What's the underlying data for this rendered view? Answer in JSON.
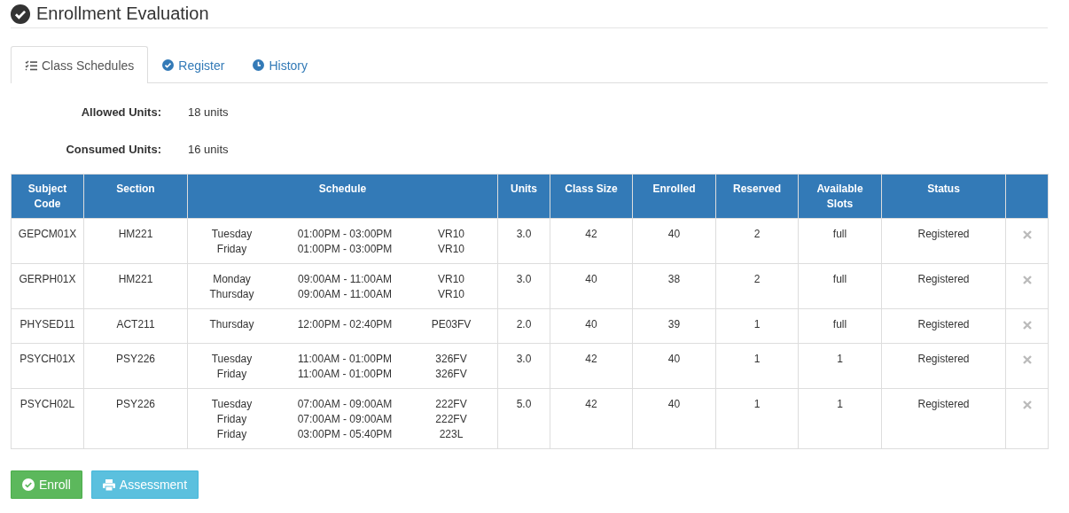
{
  "title": "Enrollment Evaluation",
  "tabs": [
    {
      "label": "Class Schedules",
      "selected": true
    },
    {
      "label": "Register",
      "selected": false
    },
    {
      "label": "History",
      "selected": false
    }
  ],
  "summary": [
    {
      "label": "Allowed Units:",
      "value": "18 units"
    },
    {
      "label": "Consumed Units:",
      "value": "16 units"
    }
  ],
  "table": {
    "columns": [
      "Subject Code",
      "Section",
      "Schedule",
      "Units",
      "Class Size",
      "Enrolled",
      "Reserved",
      "Available Slots",
      "Status"
    ],
    "rows": [
      {
        "subject_code": "GEPCM01X",
        "section": "HM221",
        "schedule": [
          {
            "day": "Tuesday",
            "time": "01:00PM - 03:00PM",
            "room": "VR10"
          },
          {
            "day": "Friday",
            "time": "01:00PM - 03:00PM",
            "room": "VR10"
          }
        ],
        "units": "3.0",
        "class_size": "42",
        "enrolled": "40",
        "reserved": "2",
        "available_slots": "full",
        "status": "Registered"
      },
      {
        "subject_code": "GERPH01X",
        "section": "HM221",
        "schedule": [
          {
            "day": "Monday",
            "time": "09:00AM - 11:00AM",
            "room": "VR10"
          },
          {
            "day": "Thursday",
            "time": "09:00AM - 11:00AM",
            "room": "VR10"
          }
        ],
        "units": "3.0",
        "class_size": "40",
        "enrolled": "38",
        "reserved": "2",
        "available_slots": "full",
        "status": "Registered"
      },
      {
        "subject_code": "PHYSED11",
        "section": "ACT211",
        "schedule": [
          {
            "day": "Thursday",
            "time": "12:00PM - 02:40PM",
            "room": "PE03FV"
          }
        ],
        "units": "2.0",
        "class_size": "40",
        "enrolled": "39",
        "reserved": "1",
        "available_slots": "full",
        "status": "Registered"
      },
      {
        "subject_code": "PSYCH01X",
        "section": "PSY226",
        "schedule": [
          {
            "day": "Tuesday",
            "time": "11:00AM - 01:00PM",
            "room": "326FV"
          },
          {
            "day": "Friday",
            "time": "11:00AM - 01:00PM",
            "room": "326FV"
          }
        ],
        "units": "3.0",
        "class_size": "42",
        "enrolled": "40",
        "reserved": "1",
        "available_slots": "1",
        "status": "Registered"
      },
      {
        "subject_code": "PSYCH02L",
        "section": "PSY226",
        "schedule": [
          {
            "day": "Tuesday",
            "time": "07:00AM - 09:00AM",
            "room": "222FV"
          },
          {
            "day": "Friday",
            "time": "07:00AM - 09:00AM",
            "room": "222FV"
          },
          {
            "day": "Friday",
            "time": "03:00PM - 05:40PM",
            "room": "223L"
          }
        ],
        "units": "5.0",
        "class_size": "42",
        "enrolled": "40",
        "reserved": "1",
        "available_slots": "1",
        "status": "Registered"
      }
    ]
  },
  "buttons": [
    {
      "label": "Enroll",
      "kind": "success"
    },
    {
      "label": "Assessment",
      "kind": "info"
    }
  ]
}
